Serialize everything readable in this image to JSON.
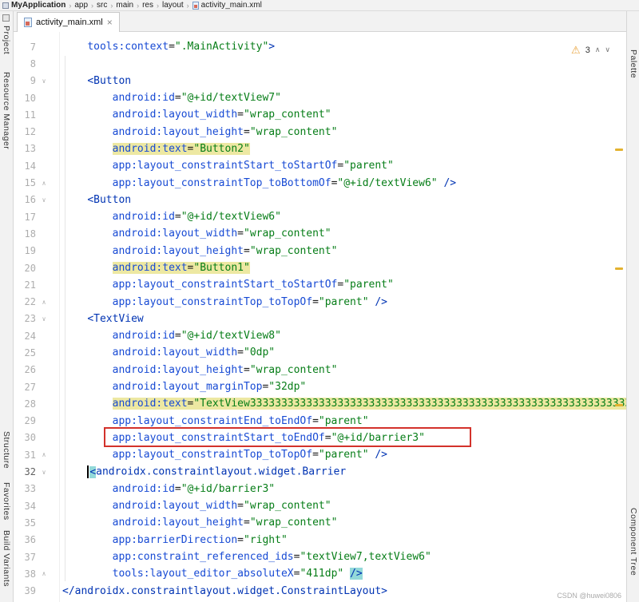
{
  "navbar": {
    "separator": "›",
    "items": [
      "MyApplication",
      "app",
      "src",
      "main",
      "res",
      "layout",
      "activity_main.xml"
    ]
  },
  "tabs": {
    "active_label": "activity_main.xml",
    "close_glyph": "×"
  },
  "left_strip": {
    "items": [
      "Project",
      "Resource Manager",
      "Structure",
      "Favorites",
      "Build Variants"
    ]
  },
  "right_strip": {
    "items": [
      "Palette",
      "Component Tree"
    ]
  },
  "editor": {
    "inspections": {
      "warning_count": "3",
      "warning_icon": "⚠",
      "prev_glyph": "∧",
      "next_glyph": "∨"
    },
    "watermark": "CSDN @huwei0806",
    "colors": {
      "tag": "#0033B3",
      "attribute": "#174AD4",
      "value": "#067D17",
      "warning_highlight": "#EDE8A2",
      "brace_highlight": "#93D9D9",
      "annotation_red": "#D3322B"
    },
    "code": {
      "lines": [
        {
          "n": 7,
          "indent": 4,
          "tokens": [
            {
              "s": "attr",
              "t": "tools:context"
            },
            {
              "s": "plain",
              "t": "="
            },
            {
              "s": "val",
              "t": "\".MainActivity\""
            },
            {
              "s": "tag",
              "t": ">"
            }
          ]
        },
        {
          "n": 8,
          "indent": 0,
          "tokens": []
        },
        {
          "n": 9,
          "indent": 4,
          "fold": "down",
          "tokens": [
            {
              "s": "tag",
              "t": "<Button"
            }
          ]
        },
        {
          "n": 10,
          "indent": 8,
          "tokens": [
            {
              "s": "attr",
              "t": "android:id"
            },
            {
              "s": "plain",
              "t": "="
            },
            {
              "s": "val",
              "t": "\"@+id/textView7\""
            }
          ]
        },
        {
          "n": 11,
          "indent": 8,
          "tokens": [
            {
              "s": "attr",
              "t": "android:layout_width"
            },
            {
              "s": "plain",
              "t": "="
            },
            {
              "s": "val",
              "t": "\"wrap_content\""
            }
          ]
        },
        {
          "n": 12,
          "indent": 8,
          "tokens": [
            {
              "s": "attr",
              "t": "android:layout_height"
            },
            {
              "s": "plain",
              "t": "="
            },
            {
              "s": "val",
              "t": "\"wrap_content\""
            }
          ]
        },
        {
          "n": 13,
          "indent": 8,
          "tokens": [
            {
              "s": "attr",
              "t": "android:text",
              "hl": "warn"
            },
            {
              "s": "plain",
              "t": "=",
              "hl": "warn"
            },
            {
              "s": "val",
              "t": "\"Button2\"",
              "hl": "warn"
            }
          ]
        },
        {
          "n": 14,
          "indent": 8,
          "tokens": [
            {
              "s": "attr",
              "t": "app:layout_constraintStart_toStartOf"
            },
            {
              "s": "plain",
              "t": "="
            },
            {
              "s": "val",
              "t": "\"parent\""
            }
          ]
        },
        {
          "n": 15,
          "indent": 8,
          "fold": "up",
          "tokens": [
            {
              "s": "attr",
              "t": "app:layout_constraintTop_toBottomOf"
            },
            {
              "s": "plain",
              "t": "="
            },
            {
              "s": "val",
              "t": "\"@+id/textView6\""
            },
            {
              "s": "tag",
              "t": " />"
            }
          ]
        },
        {
          "n": 16,
          "indent": 4,
          "fold": "down",
          "tokens": [
            {
              "s": "tag",
              "t": "<Button"
            }
          ]
        },
        {
          "n": 17,
          "indent": 8,
          "tokens": [
            {
              "s": "attr",
              "t": "android:id"
            },
            {
              "s": "plain",
              "t": "="
            },
            {
              "s": "val",
              "t": "\"@+id/textView6\""
            }
          ]
        },
        {
          "n": 18,
          "indent": 8,
          "tokens": [
            {
              "s": "attr",
              "t": "android:layout_width"
            },
            {
              "s": "plain",
              "t": "="
            },
            {
              "s": "val",
              "t": "\"wrap_content\""
            }
          ]
        },
        {
          "n": 19,
          "indent": 8,
          "tokens": [
            {
              "s": "attr",
              "t": "android:layout_height"
            },
            {
              "s": "plain",
              "t": "="
            },
            {
              "s": "val",
              "t": "\"wrap_content\""
            }
          ]
        },
        {
          "n": 20,
          "indent": 8,
          "tokens": [
            {
              "s": "attr",
              "t": "android:text",
              "hl": "warn"
            },
            {
              "s": "plain",
              "t": "=",
              "hl": "warn"
            },
            {
              "s": "val",
              "t": "\"Button1\"",
              "hl": "warn"
            }
          ]
        },
        {
          "n": 21,
          "indent": 8,
          "tokens": [
            {
              "s": "attr",
              "t": "app:layout_constraintStart_toStartOf"
            },
            {
              "s": "plain",
              "t": "="
            },
            {
              "s": "val",
              "t": "\"parent\""
            }
          ]
        },
        {
          "n": 22,
          "indent": 8,
          "fold": "up",
          "tokens": [
            {
              "s": "attr",
              "t": "app:layout_constraintTop_toTopOf"
            },
            {
              "s": "plain",
              "t": "="
            },
            {
              "s": "val",
              "t": "\"parent\""
            },
            {
              "s": "tag",
              "t": " />"
            }
          ]
        },
        {
          "n": 23,
          "indent": 4,
          "fold": "down",
          "tokens": [
            {
              "s": "tag",
              "t": "<TextView"
            }
          ]
        },
        {
          "n": 24,
          "indent": 8,
          "tokens": [
            {
              "s": "attr",
              "t": "android:id"
            },
            {
              "s": "plain",
              "t": "="
            },
            {
              "s": "val",
              "t": "\"@+id/textView8\""
            }
          ]
        },
        {
          "n": 25,
          "indent": 8,
          "tokens": [
            {
              "s": "attr",
              "t": "android:layout_width"
            },
            {
              "s": "plain",
              "t": "="
            },
            {
              "s": "val",
              "t": "\"0dp\""
            }
          ]
        },
        {
          "n": 26,
          "indent": 8,
          "tokens": [
            {
              "s": "attr",
              "t": "android:layout_height"
            },
            {
              "s": "plain",
              "t": "="
            },
            {
              "s": "val",
              "t": "\"wrap_content\""
            }
          ]
        },
        {
          "n": 27,
          "indent": 8,
          "tokens": [
            {
              "s": "attr",
              "t": "android:layout_marginTop"
            },
            {
              "s": "plain",
              "t": "="
            },
            {
              "s": "val",
              "t": "\"32dp\""
            }
          ]
        },
        {
          "n": 28,
          "indent": 8,
          "tokens": [
            {
              "s": "attr",
              "t": "android:text",
              "hl": "warn"
            },
            {
              "s": "plain",
              "t": "=",
              "hl": "warn"
            },
            {
              "s": "val",
              "t": "\"TextView3333333333333333333333333333333333333333333333333333333333333333333333333333333333",
              "hl": "warn"
            }
          ]
        },
        {
          "n": 29,
          "indent": 8,
          "tokens": [
            {
              "s": "attr",
              "t": "app:layout_constraintEnd_toEndOf"
            },
            {
              "s": "plain",
              "t": "="
            },
            {
              "s": "val",
              "t": "\"parent\""
            }
          ]
        },
        {
          "n": 30,
          "indent": 8,
          "tokens": [
            {
              "s": "attr",
              "t": "app:layout_constraintStart_toEndOf"
            },
            {
              "s": "plain",
              "t": "="
            },
            {
              "s": "val",
              "t": "\"@+id/barrier3\""
            }
          ]
        },
        {
          "n": 31,
          "indent": 8,
          "fold": "up",
          "tokens": [
            {
              "s": "attr",
              "t": "app:layout_constraintTop_toTopOf"
            },
            {
              "s": "plain",
              "t": "="
            },
            {
              "s": "val",
              "t": "\"parent\""
            },
            {
              "s": "tag",
              "t": " />"
            }
          ]
        },
        {
          "n": 32,
          "indent": 4,
          "fold": "down",
          "caret": true,
          "tokens": [
            {
              "s": "tag",
              "t": "<",
              "hl": "brace"
            },
            {
              "s": "tag",
              "t": "androidx.constraintlayout.widget.Barrier"
            }
          ]
        },
        {
          "n": 33,
          "indent": 8,
          "tokens": [
            {
              "s": "attr",
              "t": "android:id"
            },
            {
              "s": "plain",
              "t": "="
            },
            {
              "s": "val",
              "t": "\"@+id/barrier3\""
            }
          ]
        },
        {
          "n": 34,
          "indent": 8,
          "tokens": [
            {
              "s": "attr",
              "t": "android:layout_width"
            },
            {
              "s": "plain",
              "t": "="
            },
            {
              "s": "val",
              "t": "\"wrap_content\""
            }
          ]
        },
        {
          "n": 35,
          "indent": 8,
          "tokens": [
            {
              "s": "attr",
              "t": "android:layout_height"
            },
            {
              "s": "plain",
              "t": "="
            },
            {
              "s": "val",
              "t": "\"wrap_content\""
            }
          ]
        },
        {
          "n": 36,
          "indent": 8,
          "tokens": [
            {
              "s": "attr",
              "t": "app:barrierDirection"
            },
            {
              "s": "plain",
              "t": "="
            },
            {
              "s": "val",
              "t": "\"right\""
            }
          ]
        },
        {
          "n": 37,
          "indent": 8,
          "tokens": [
            {
              "s": "attr",
              "t": "app:constraint_referenced_ids"
            },
            {
              "s": "plain",
              "t": "="
            },
            {
              "s": "val",
              "t": "\"textView7,textView6\""
            }
          ]
        },
        {
          "n": 38,
          "indent": 8,
          "fold": "up",
          "tokens": [
            {
              "s": "attr",
              "t": "tools:layout_editor_absoluteX"
            },
            {
              "s": "plain",
              "t": "="
            },
            {
              "s": "val",
              "t": "\"411dp\""
            },
            {
              "s": "plain",
              "t": " "
            },
            {
              "s": "tag",
              "t": "/>",
              "hl": "brace"
            }
          ]
        },
        {
          "n": 39,
          "indent": 0,
          "tokens": [
            {
              "s": "tag",
              "t": "</androidx.constraintlayout.widget.ConstraintLayout>"
            }
          ]
        }
      ]
    }
  }
}
